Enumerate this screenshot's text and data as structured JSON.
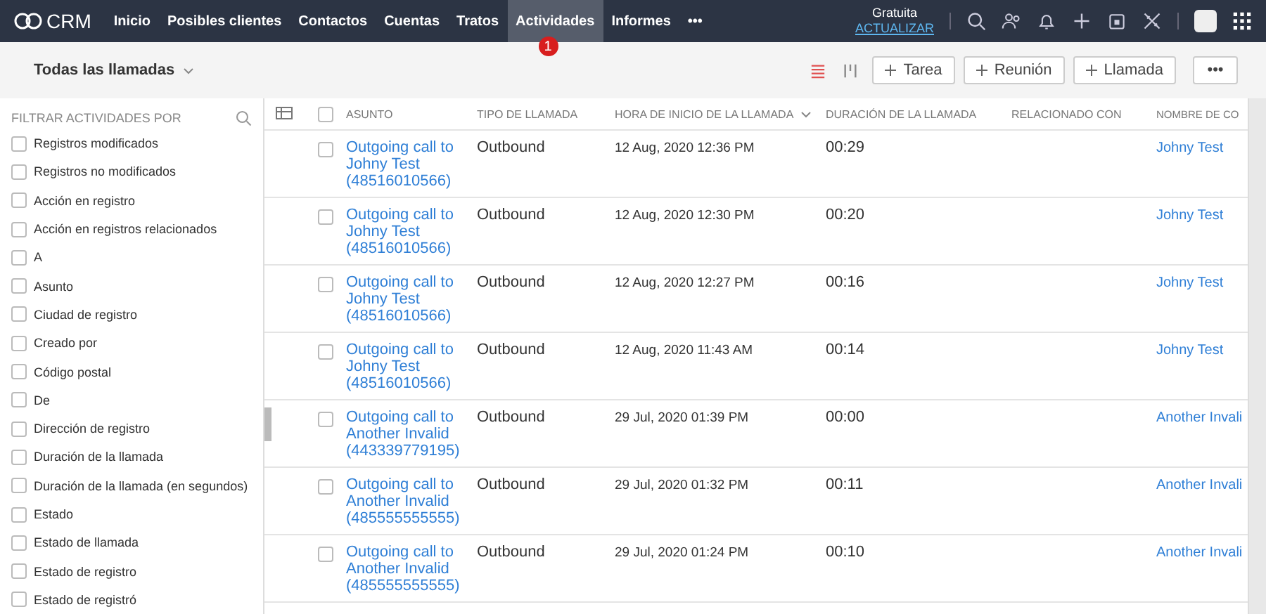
{
  "topbar": {
    "logo": "CRM",
    "nav": [
      {
        "label": "Inicio",
        "selected": false
      },
      {
        "label": "Posibles clientes",
        "selected": false
      },
      {
        "label": "Contactos",
        "selected": false
      },
      {
        "label": "Cuentas",
        "selected": false
      },
      {
        "label": "Tratos",
        "selected": false
      },
      {
        "label": "Actividades",
        "selected": true,
        "badge": "1"
      },
      {
        "label": "Informes",
        "selected": false
      },
      {
        "label": "•••",
        "selected": false
      }
    ],
    "plan": "Gratuita",
    "upgrade": "ACTUALIZAR"
  },
  "toolbar": {
    "view": "Todas las llamadas",
    "buttons": [
      {
        "label": "Tarea",
        "kind": "add"
      },
      {
        "label": "Reunión",
        "kind": "add"
      },
      {
        "label": "Llamada",
        "kind": "add"
      },
      {
        "label": "•••",
        "kind": "more"
      }
    ]
  },
  "sidebar": {
    "title": "FILTRAR ACTIVIDADES POR",
    "filters": [
      {
        "label": "Registros modificados",
        "checked": false
      },
      {
        "label": "Registros no modificados",
        "checked": false
      },
      {
        "label": "Acción en registro",
        "checked": false
      },
      {
        "label": "Acción en registros relacionados",
        "checked": false
      },
      {
        "label": "A",
        "checked": false
      },
      {
        "label": "Asunto",
        "checked": false
      },
      {
        "label": "Ciudad de registro",
        "checked": false
      },
      {
        "label": "Creado por",
        "checked": false
      },
      {
        "label": "Código postal",
        "checked": false
      },
      {
        "label": "De",
        "checked": false
      },
      {
        "label": "Dirección de registro",
        "checked": false
      },
      {
        "label": "Duración de la llamada",
        "checked": false
      },
      {
        "label": "Duración de la llamada (en segundos)",
        "checked": false
      },
      {
        "label": "Estado",
        "checked": false
      },
      {
        "label": "Estado de llamada",
        "checked": false
      },
      {
        "label": "Estado de registro",
        "checked": false
      },
      {
        "label": "Estado de registró",
        "checked": false
      }
    ]
  },
  "table": {
    "all_checked": false,
    "columns": [
      "ASUNTO",
      "TIPO DE LLAMADA",
      "HORA DE INICIO DE LA LLAMADA",
      "DURACIÓN DE LA LLAMADA",
      "RELACIONADO CON",
      "NOMBRE DE CO"
    ],
    "rows": [
      {
        "checked": false,
        "subject": "Outgoing call to\nJohny Test\n(48516010566)",
        "type": "Outbound",
        "start": "12 Aug, 2020 12:36 PM",
        "duration": "00:29",
        "contact": "Johny Test"
      },
      {
        "checked": false,
        "subject": "Outgoing call to\nJohny Test\n(48516010566)",
        "type": "Outbound",
        "start": "12 Aug, 2020 12:30 PM",
        "duration": "00:20",
        "contact": "Johny Test"
      },
      {
        "checked": false,
        "subject": "Outgoing call to\nJohny Test\n(48516010566)",
        "type": "Outbound",
        "start": "12 Aug, 2020 12:27 PM",
        "duration": "00:16",
        "contact": "Johny Test"
      },
      {
        "checked": false,
        "subject": "Outgoing call to\nJohny Test\n(48516010566)",
        "type": "Outbound",
        "start": "12 Aug, 2020 11:43 AM",
        "duration": "00:14",
        "contact": "Johny Test"
      },
      {
        "checked": false,
        "subject": "Outgoing call to\nAnother Invalid\n(443339779195)",
        "type": "Outbound",
        "start": "29 Jul, 2020 01:39 PM",
        "duration": "00:00",
        "contact": "Another Invali"
      },
      {
        "checked": false,
        "subject": "Outgoing call to\nAnother Invalid\n(485555555555)",
        "type": "Outbound",
        "start": "29 Jul, 2020 01:32 PM",
        "duration": "00:11",
        "contact": "Another Invali"
      },
      {
        "checked": false,
        "subject": "Outgoing call to\nAnother Invalid\n(485555555555)",
        "type": "Outbound",
        "start": "29 Jul, 2020 01:24 PM",
        "duration": "00:10",
        "contact": "Another Invali"
      }
    ]
  }
}
